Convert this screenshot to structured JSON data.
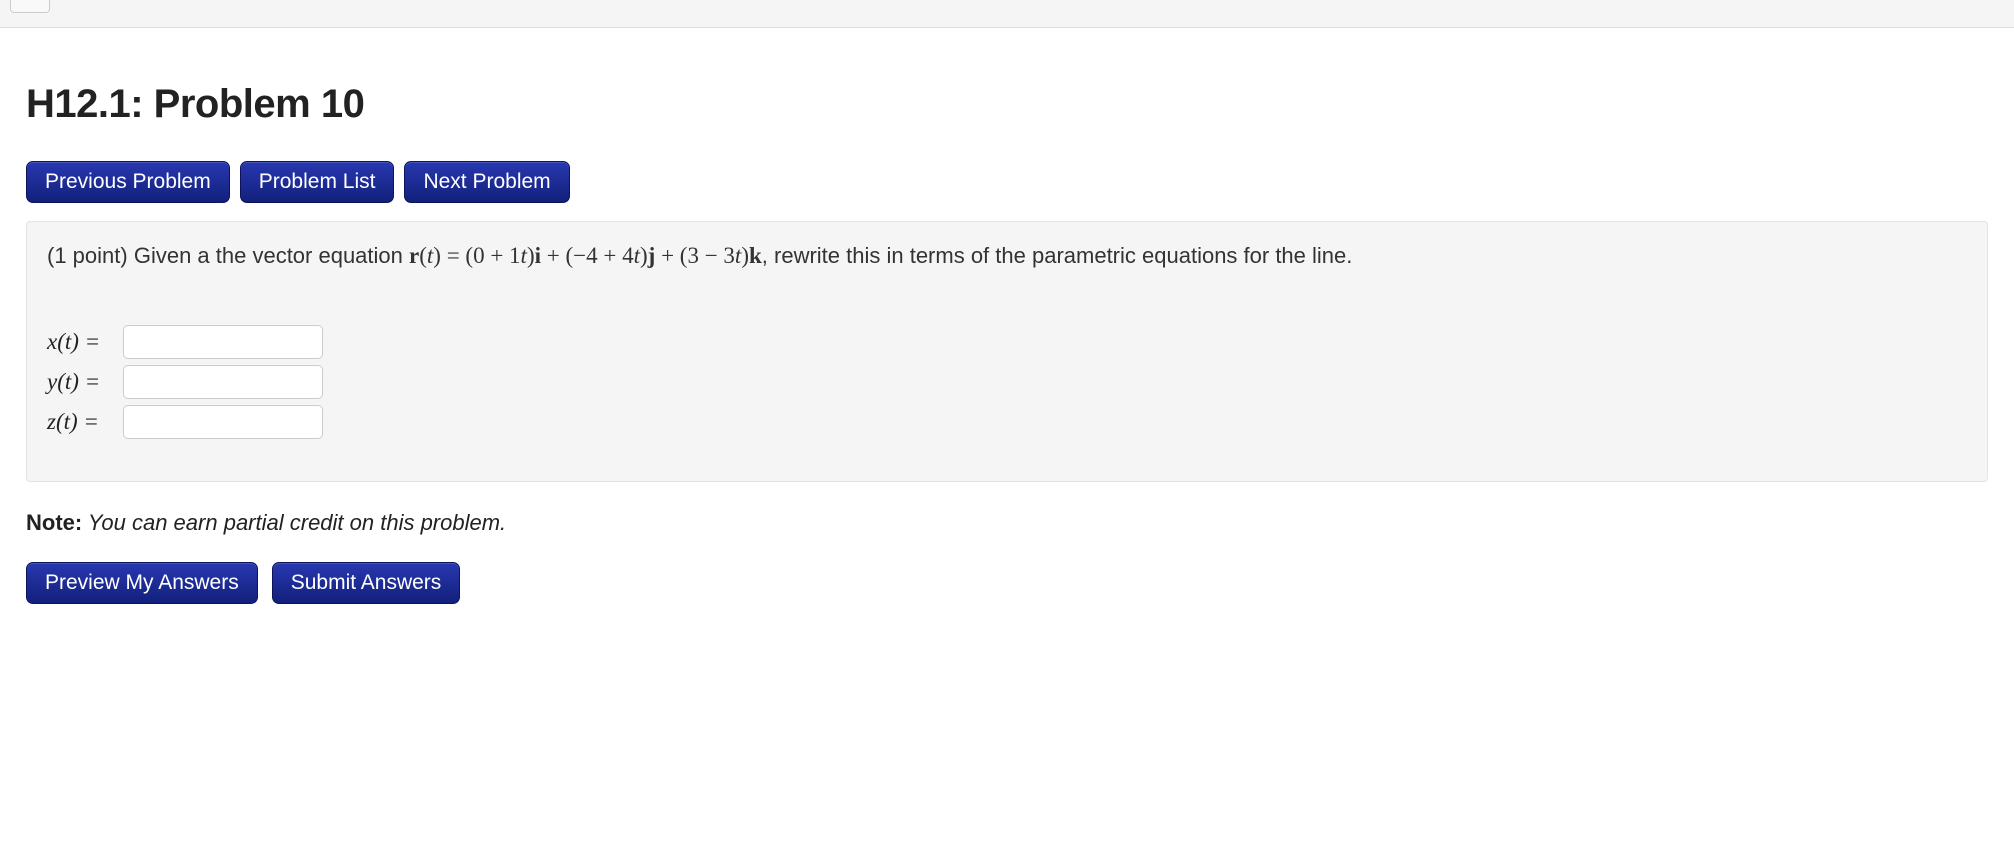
{
  "topbar": {
    "button_label": ""
  },
  "title": "H12.1: Problem 10",
  "nav": {
    "prev": "Previous Problem",
    "list": "Problem List",
    "next": "Next Problem"
  },
  "problem": {
    "points_prefix": "(1 point) ",
    "lead": "Given a the vector equation ",
    "r_label": "r",
    "t_open": "(",
    "t_var": "t",
    "t_close": ") = (0 + 1",
    "t_var2": "t",
    "close_i": ")",
    "i": "i",
    "plus1": " + (−4 + 4",
    "t_var3": "t",
    "close_j": ")",
    "j": "j",
    "plus2": " + (3 − 3",
    "t_var4": "t",
    "close_k": ")",
    "k": "k",
    "trail": ", rewrite this in terms of the parametric equations for the line."
  },
  "inputs": {
    "x_label": "x(t) =",
    "y_label": "y(t) =",
    "z_label": "z(t) =",
    "x_value": "",
    "y_value": "",
    "z_value": ""
  },
  "note": {
    "label": "Note:",
    "text": " You can earn partial credit on this problem."
  },
  "actions": {
    "preview": "Preview My Answers",
    "submit": "Submit Answers"
  }
}
